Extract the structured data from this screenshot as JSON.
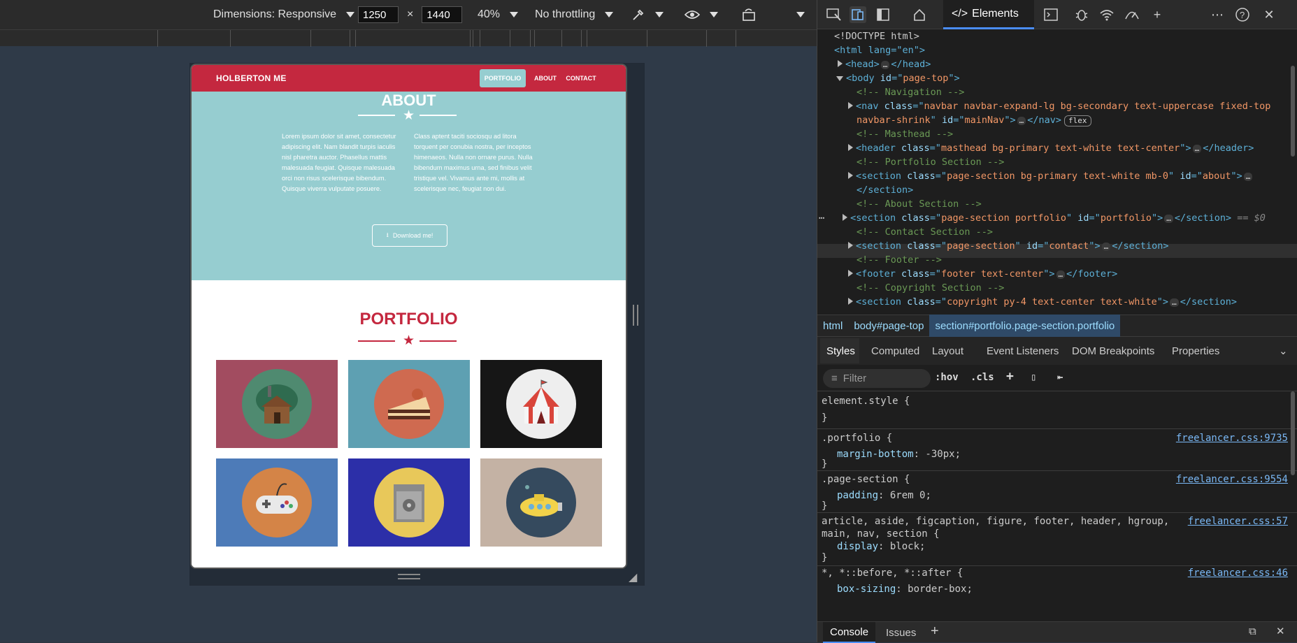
{
  "toolbar": {
    "dimensions": "Dimensions: Responsive",
    "width": "1250",
    "x": "×",
    "height": "1440",
    "zoom": "40%",
    "throttle": "No throttling"
  },
  "site": {
    "brand": "HOLBERTON ME",
    "nav": [
      "PORTFOLIO",
      "ABOUT",
      "CONTACT"
    ],
    "about_title": "ABOUT",
    "about_left": "Lorem ipsum dolor sit amet, consectetur adipiscing elit. Nam blandit turpis iaculis nisl pharetra auctor. Phasellus mattis malesuada feugiat. Quisque malesuada orci non risus scelerisque bibendum. Quisque viverra vulputate posuere.",
    "about_right": "Class aptent taciti sociosqu ad litora torquent per conubia nostra, per inceptos himenaeos. Nulla non ornare purus. Nulla bibendum maximus urna, sed finibus velit tristique vel. Vivamus ante mi, mollis at scelerisque nec, feugiat non dui.",
    "download": "Download me!",
    "portfolio_title": "PORTFOLIO",
    "colors": {
      "primary": "#c4283f",
      "about_bg": "#96cdd0"
    },
    "cards": [
      {
        "icon": "cabin-icon",
        "bg": "#a24c60",
        "disc": "#4f8a70"
      },
      {
        "icon": "cake-icon",
        "bg": "#5ea0b2",
        "disc": "#cf6a50"
      },
      {
        "icon": "circus-tent-icon",
        "bg": "#161616",
        "disc": "#eeeeee"
      },
      {
        "icon": "gamepad-icon",
        "bg": "#4d7bb8",
        "disc": "#d48447"
      },
      {
        "icon": "safe-icon",
        "bg": "#2c2fa8",
        "disc": "#e8c85a"
      },
      {
        "icon": "submarine-icon",
        "bg": "#c4b2a4",
        "disc": "#354a5e"
      }
    ]
  },
  "devtools": {
    "elements_tab": "Elements",
    "dom": {
      "doctype": "<!DOCTYPE html>",
      "html_open": "<html lang=\"en\">",
      "head": "head",
      "body": "body",
      "body_id": "page-top",
      "c_nav": "<!-- Navigation -->",
      "nav_class": "navbar navbar-expand-lg bg-secondary text-uppercase fixed-top",
      "nav_class2": "navbar-shrink",
      "nav_id": "mainNav",
      "flex": "flex",
      "c_mast": "<!-- Masthead -->",
      "header_class": "masthead bg-primary text-white text-center",
      "c_port": "<!-- Portfolio Section -->",
      "sec1_class": "page-section bg-primary text-white mb-0",
      "sec1_id": "about",
      "section_close": "</section>",
      "c_about": "<!-- About Section -->",
      "sec2_class": "page-section portfolio",
      "sec2_id": "portfolio",
      "sel_marker": "== $0",
      "c_contact": "<!-- Contact Section -->",
      "sec3_class": "page-section",
      "sec3_id": "contact",
      "c_footer": "<!-- Footer -->",
      "footer_class": "footer text-center",
      "c_copy": "<!-- Copyright Section -->",
      "sec4_class": "copyright py-4 text-center text-white"
    },
    "breadcrumb": [
      "html",
      "body#page-top",
      "section#portfolio.page-section.portfolio"
    ],
    "style_tabs": [
      "Styles",
      "Computed",
      "Layout",
      "Event Listeners",
      "DOM Breakpoints",
      "Properties"
    ],
    "filter_placeholder": "Filter",
    "hov": ":hov",
    "cls": ".cls",
    "rules": {
      "r1_sel": "element.style {",
      "close": "}",
      "r2_sel": ".portfolio {",
      "r2_src": "freelancer.css:9735",
      "r2_prop": "margin-bottom",
      "r2_val": ": -30px;",
      "r3_sel": ".page-section {",
      "r3_src": "freelancer.css:9554",
      "r3_prop": "padding",
      "r3_val": ": 6rem 0;",
      "r4_sel1": "article, aside, figcaption, figure, footer, header, hgroup,",
      "r4_sel2": "main, nav, section {",
      "r4_src": "freelancer.css:57",
      "r4_prop": "display",
      "r4_val": ": block;",
      "r5_sel": "*, *::before, *::after {",
      "r5_src": "freelancer.css:46",
      "r5_prop": "box-sizing",
      "r5_val": ": border-box;"
    },
    "drawer": [
      "Console",
      "Issues"
    ]
  }
}
